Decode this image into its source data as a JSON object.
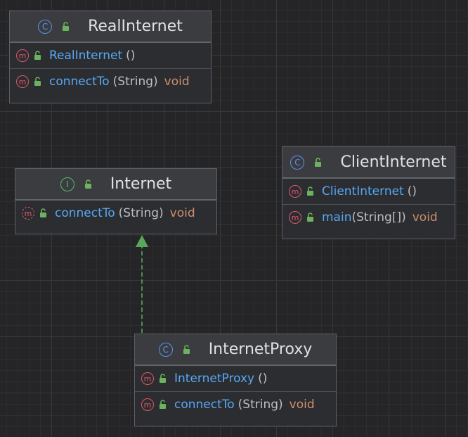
{
  "colors": {
    "background": "#252527",
    "class_icon": "#5f8fe8",
    "interface_icon": "#58b96a",
    "method_icon": "#e0576a",
    "lock_icon": "#6db35f",
    "method_name": "#57a8f5",
    "return_type": "#cf8e6d",
    "arrow": "#5aa65a"
  },
  "icons": {
    "class": "C",
    "interface": "I",
    "method": "m"
  },
  "classes": {
    "real_internet": {
      "kind": "class",
      "name": "RealInternet",
      "members": [
        {
          "name": "RealInternet",
          "params": "()",
          "return_type": ""
        },
        {
          "name": "connectTo",
          "params": "(String)",
          "return_type": "void"
        }
      ]
    },
    "internet": {
      "kind": "interface",
      "name": "Internet",
      "members": [
        {
          "name": "connectTo",
          "params": "(String)",
          "return_type": "void"
        }
      ]
    },
    "client_internet": {
      "kind": "class",
      "name": "ClientInternet",
      "members": [
        {
          "name": "ClientInternet",
          "params": "()",
          "return_type": ""
        },
        {
          "name": "main",
          "params": "(String[])",
          "return_type": "void"
        }
      ]
    },
    "internet_proxy": {
      "kind": "class",
      "name": "InternetProxy",
      "members": [
        {
          "name": "InternetProxy",
          "params": "()",
          "return_type": ""
        },
        {
          "name": "connectTo",
          "params": "(String)",
          "return_type": "void"
        }
      ]
    }
  },
  "relations": [
    {
      "from": "InternetProxy",
      "to": "Internet",
      "type": "implements"
    }
  ]
}
